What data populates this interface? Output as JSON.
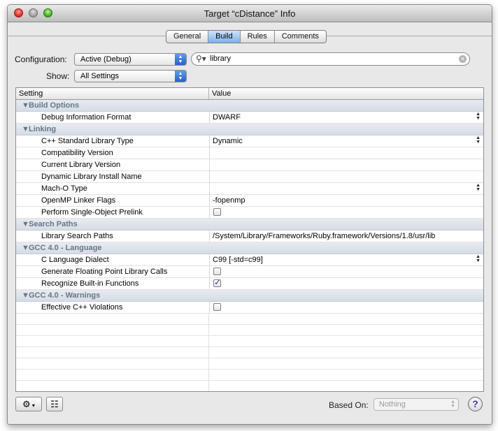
{
  "window": {
    "title": "Target “cDistance” Info"
  },
  "tabs": [
    {
      "label": "General",
      "active": false
    },
    {
      "label": "Build",
      "active": true
    },
    {
      "label": "Rules",
      "active": false
    },
    {
      "label": "Comments",
      "active": false
    }
  ],
  "config": {
    "label": "Configuration:",
    "value": "Active (Debug)"
  },
  "show": {
    "label": "Show:",
    "value": "All Settings"
  },
  "search": {
    "value": "library"
  },
  "table": {
    "col_setting": "Setting",
    "col_value": "Value",
    "rows": [
      {
        "type": "group",
        "label": "Build Options"
      },
      {
        "type": "setting",
        "label": "Debug Information Format",
        "value": "DWARF",
        "stepper": true
      },
      {
        "type": "group",
        "label": "Linking"
      },
      {
        "type": "setting",
        "label": "C++ Standard Library Type",
        "value": "Dynamic",
        "stepper": true
      },
      {
        "type": "setting",
        "label": "Compatibility Version",
        "value": ""
      },
      {
        "type": "setting",
        "label": "Current Library Version",
        "value": ""
      },
      {
        "type": "setting",
        "label": "Dynamic Library Install Name",
        "value": ""
      },
      {
        "type": "setting",
        "label": "Mach-O Type",
        "value": "",
        "stepper": true
      },
      {
        "type": "setting",
        "label": "OpenMP Linker Flags",
        "value": "-fopenmp"
      },
      {
        "type": "setting",
        "label": "Perform Single-Object Prelink",
        "checkbox": true,
        "checked": false
      },
      {
        "type": "group",
        "label": "Search Paths"
      },
      {
        "type": "setting",
        "label": "Library Search Paths",
        "value": "/System/Library/Frameworks/Ruby.framework/Versions/1.8/usr/lib"
      },
      {
        "type": "group",
        "label": "GCC 4.0 - Language"
      },
      {
        "type": "setting",
        "label": "C Language Dialect",
        "value": "C99 [-std=c99]",
        "stepper": true
      },
      {
        "type": "setting",
        "label": "Generate Floating Point Library Calls",
        "checkbox": true,
        "checked": false
      },
      {
        "type": "setting",
        "label": "Recognize Built-in Functions",
        "checkbox": true,
        "checked": true
      },
      {
        "type": "group",
        "label": "GCC 4.0 - Warnings"
      },
      {
        "type": "setting",
        "label": "Effective C++ Violations",
        "checkbox": true,
        "checked": false
      }
    ]
  },
  "footer": {
    "based_on_label": "Based On:",
    "based_on_value": "Nothing",
    "help": "?"
  },
  "colors": {
    "accent": "#3b7de0",
    "group_text": "#687586"
  }
}
